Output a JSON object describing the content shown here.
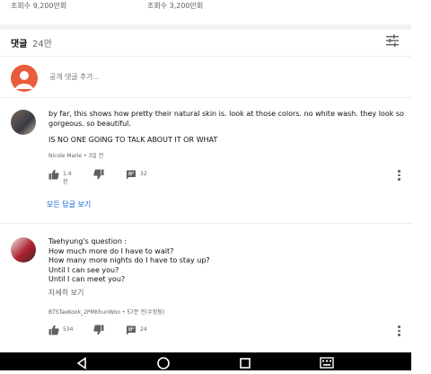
{
  "views": {
    "left": "조회수 9,200만회",
    "right": "조회수 3,200만회"
  },
  "comments_header": {
    "title": "댓글",
    "count": "24만"
  },
  "add_comment": {
    "placeholder": "공개 댓글 추가..."
  },
  "comments": [
    {
      "lines": [
        "by far, this shows how pretty their natural skin is. look at those colors. no white wash. they look so",
        "gorgeous. so beautiful.",
        "",
        "IS NO ONE GOING TO TALK ABOUT IT OR WHAT"
      ],
      "author": "Nicole Marie",
      "time": "3일 전",
      "likes": "1.4천",
      "reply_count": "32",
      "view_replies": "모든 답글 보기"
    },
    {
      "lines": [
        "Taehyung's question :",
        "How much more do I have to wait?",
        "How many more nights do I have to stay up?",
        "Until I can see you?",
        "Until I can meet you?"
      ],
      "read_more": "자세히 보기",
      "author": "BTSTaeKook_2PMKhunWoo",
      "time": "57분 전(수정됨)",
      "likes": "534",
      "reply_count": "24"
    }
  ],
  "colors": {
    "link": "#065fd4",
    "avatar": "#e85d3a",
    "navbar": "#000000"
  },
  "icons": [
    "sort-icon",
    "thumbs-up-icon",
    "thumbs-down-icon",
    "reply-icon",
    "more-vert-icon",
    "nav-back-icon",
    "nav-home-icon",
    "nav-recents-icon",
    "nav-keyboard-icon"
  ]
}
